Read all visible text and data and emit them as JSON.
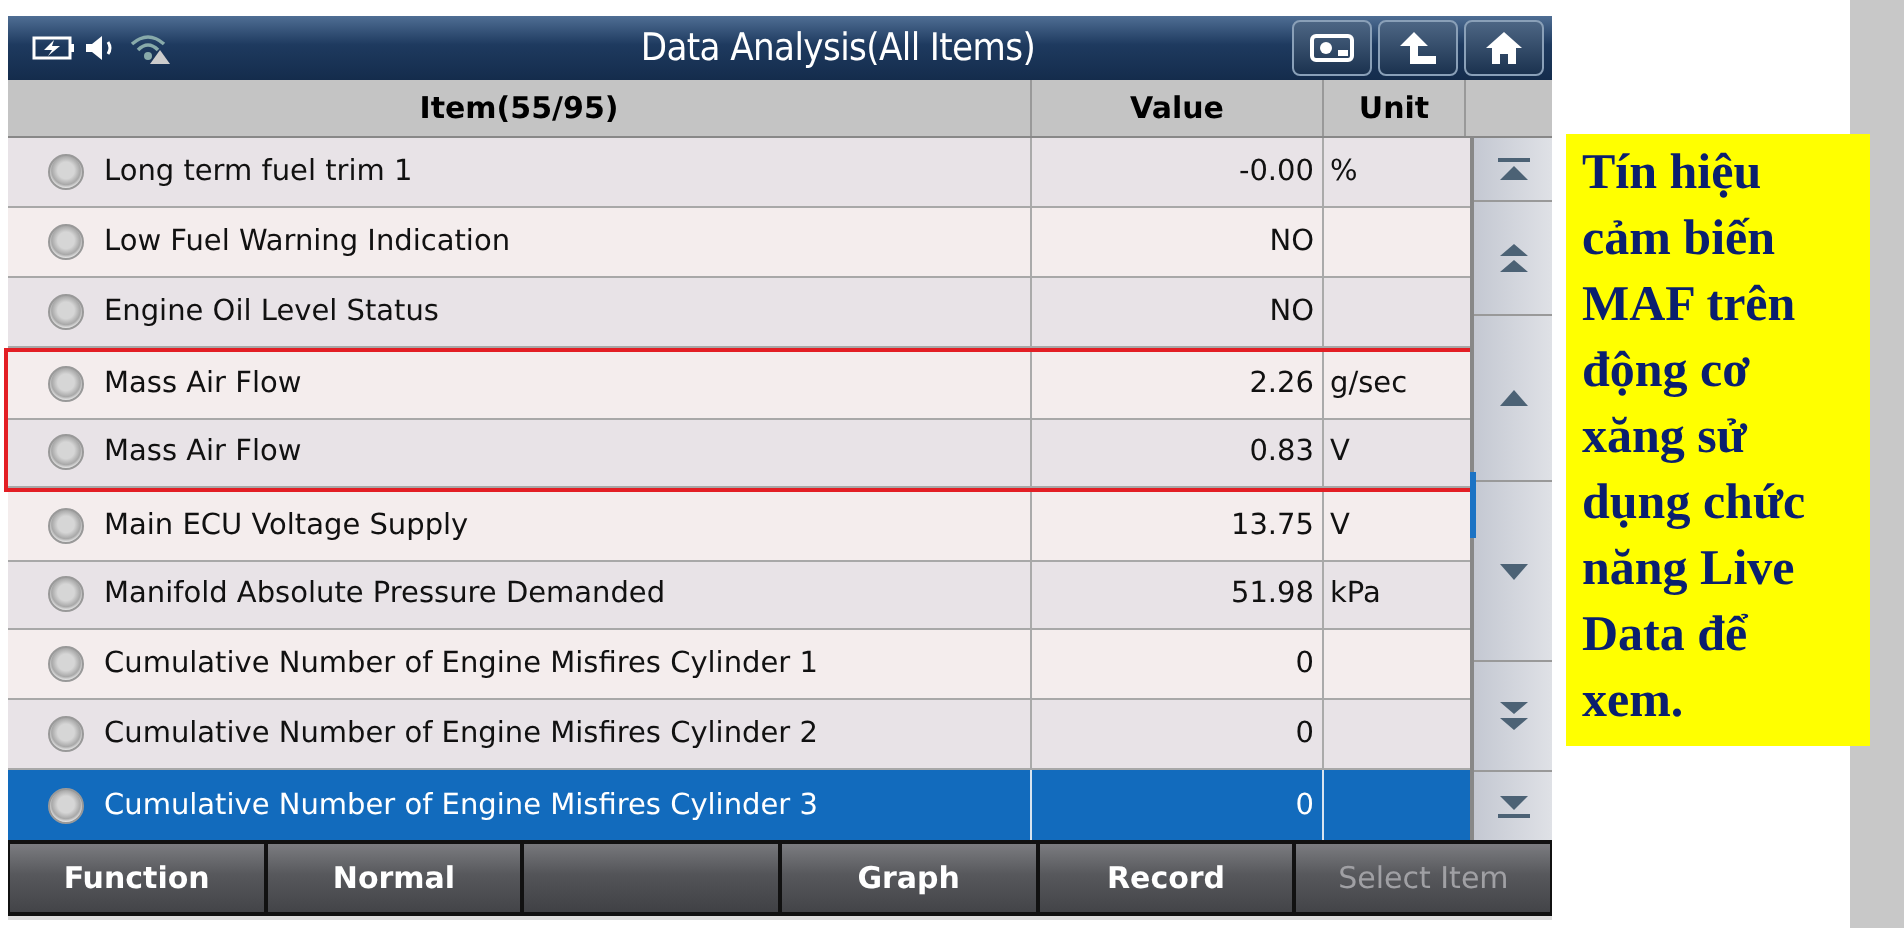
{
  "window": {
    "title": "Data Analysis(All Items)"
  },
  "table": {
    "columns": [
      "Item(55/95)",
      "Value",
      "Unit"
    ],
    "rows": [
      {
        "item": "Long term fuel trim 1",
        "value": "-0.00",
        "unit": "%",
        "selected": false,
        "boxed": false
      },
      {
        "item": "Low Fuel Warning Indication",
        "value": "NO",
        "selected": false,
        "boxed": false
      },
      {
        "item": "Engine Oil Level Status",
        "value": "NO",
        "selected": false,
        "boxed": false
      },
      {
        "item": "Mass Air Flow",
        "value": "2.26",
        "unit": "g/sec",
        "selected": false,
        "boxed": true
      },
      {
        "item": "Mass Air Flow",
        "value": "0.83",
        "unit": "V",
        "selected": false,
        "boxed": true
      },
      {
        "item": "Main ECU Voltage Supply",
        "value": "13.75",
        "unit": "V",
        "selected": false,
        "boxed": false
      },
      {
        "item": "Manifold Absolute Pressure Demanded",
        "value": "51.98",
        "unit": "kPa",
        "selected": false,
        "boxed": false
      },
      {
        "item": "Cumulative Number of Engine Misfires Cylinder 1",
        "value": "0",
        "selected": false,
        "boxed": false
      },
      {
        "item": "Cumulative Number of Engine Misfires Cylinder 2",
        "value": "0",
        "selected": false,
        "boxed": false
      },
      {
        "item": "Cumulative Number of Engine Misfires Cylinder 3",
        "value": "0",
        "selected": true,
        "boxed": false
      }
    ]
  },
  "toolbar": [
    {
      "kind": "button",
      "label": "Function",
      "disabled": false
    },
    {
      "kind": "button",
      "label": "Normal",
      "disabled": false
    },
    {
      "kind": "blank"
    },
    {
      "kind": "button",
      "label": "Graph",
      "disabled": false
    },
    {
      "kind": "button",
      "label": "Record",
      "disabled": false
    },
    {
      "kind": "button",
      "label": "Select Item",
      "disabled": true
    }
  ],
  "note": "Tín hiệu cảm biến MAF trên động cơ xăng sử dụng chức năng Live Data để xem."
}
